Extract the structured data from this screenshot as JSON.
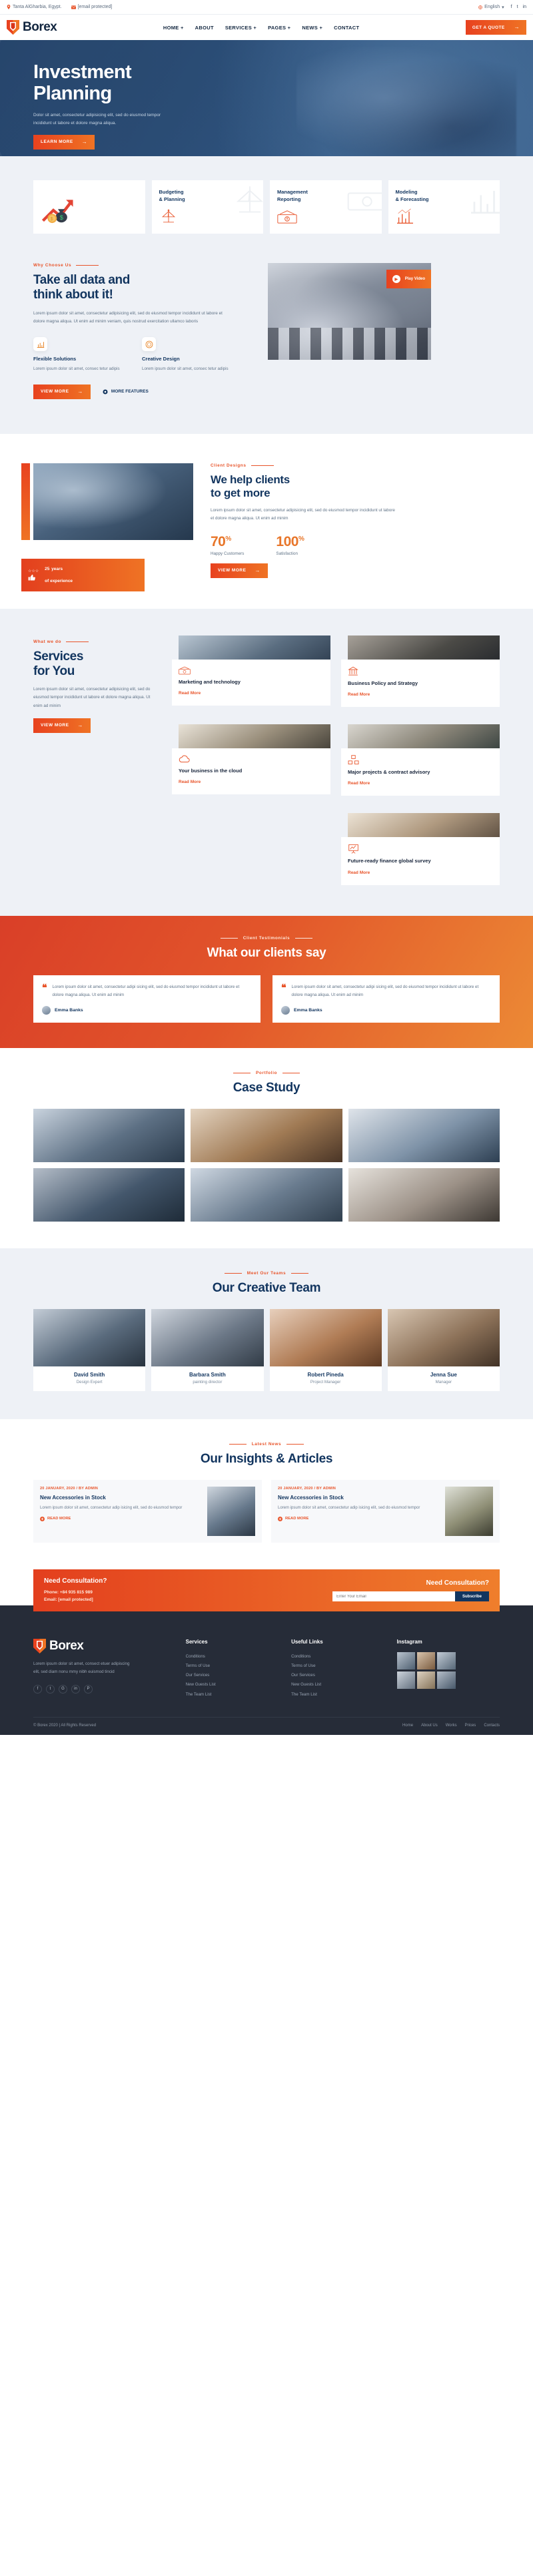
{
  "brand": {
    "name": "Borex",
    "accent": "#e8542a",
    "navy": "#12355f",
    "dark_footer": "#262c38"
  },
  "topbar": {
    "location": "Tanta AlGharbia, Egypt.",
    "email": "[email protected]",
    "language": "English",
    "location_icon": "map-pin-icon",
    "email_icon": "envelope-icon",
    "globe_icon": "globe-icon",
    "socials": [
      "f",
      "t",
      "in"
    ]
  },
  "header": {
    "nav": [
      {
        "label": "HOME +"
      },
      {
        "label": "ABOUT"
      },
      {
        "label": "SERVICES +"
      },
      {
        "label": "PAGES +"
      },
      {
        "label": "NEWS +"
      },
      {
        "label": "CONTACT"
      }
    ],
    "cta": "GET A QUOTE"
  },
  "hero": {
    "title_line1": "Investment",
    "title_line2": "Planning",
    "desc": "Dolor sit amet, consectetur adipisicing elit, sed do eiusmod tempor incididunt ut labore et dolore magna aliqua.",
    "button": "LEARN MORE"
  },
  "features": [
    {
      "title": "",
      "icon": "money-growth-icon"
    },
    {
      "title": "Budgeting\n& Planning",
      "icon": "scales-icon"
    },
    {
      "title": "Management\nReporting",
      "icon": "banknote-icon"
    },
    {
      "title": "Modeling\n& Forecasting",
      "icon": "bar-chart-icon"
    }
  ],
  "why": {
    "eyebrow": "Why Choose Us",
    "title_line1": "Take all data and",
    "title_line2": "think about it!",
    "desc": "Lorem ipsum dolor sit amet, consectetur adipisicing elit, sed do eiusmod tempor incididunt ut labore et dolore magna aliqua. Ut enim ad minim veniam, quis nostrud exercitation ullamco laboris",
    "minis": [
      {
        "title": "Flexible Solutions",
        "desc": "Lorem ipsum dolor sit amet, consec tetur adipis",
        "icon": "chart-icon"
      },
      {
        "title": "Creative Design",
        "desc": "Lorem ipsum dolor sit amet, consec tetur adipis",
        "icon": "coin-icon"
      }
    ],
    "button": "VIEW MORE",
    "more_features": "MORE FEATURES",
    "play_label": "Play Video"
  },
  "clients": {
    "eyebrow": "Client Designs",
    "title_line1": "We help clients",
    "title_line2": "to get more",
    "desc": "Lorem ipsum dolor sit amet, consectetur adipisicing elit, sed do eiusmod tempor incididunt ut labore et dolore magna aliqua. Ut enim ad minim",
    "stats": [
      {
        "value": "70",
        "unit": "%",
        "label": "Happy Customers"
      },
      {
        "value": "100",
        "unit": "%",
        "label": "Satisfaction"
      }
    ],
    "button": "VIEW MORE",
    "badge_years": "25",
    "badge_years_suffix": "years",
    "badge_text": "of experience"
  },
  "services": {
    "eyebrow": "What we do",
    "title_line1": "Services",
    "title_line2": "for You",
    "desc": "Lorem ipsum dolor sit amet, consectetur adipisicing elit, sed do eiusmod tempor incididunt ut labore et dolore magna aliqua. Ut enim ad minim",
    "button": "VIEW MORE",
    "read_more": "Read More",
    "cards": [
      {
        "title": "Marketing and technology",
        "icon": "banknote-icon"
      },
      {
        "title": "Business Policy and Strategy",
        "icon": "bank-icon"
      },
      {
        "title": "Your business in the cloud",
        "icon": "cloud-icon"
      },
      {
        "title": "Major projects & contract advisory",
        "icon": "boxes-icon"
      },
      {
        "title": "Future-ready finance global survey",
        "icon": "presentation-icon"
      }
    ]
  },
  "testimonials": {
    "eyebrow": "Client Testimonials",
    "title": "What our clients say",
    "items": [
      {
        "quote": "Lorem ipsum dolor sit amet, consectetur adipi sicing elit, sed do eiusmod tempor incididunt ut labore et dolore magna aliqua. Ut enim ad minim",
        "author": "Emma Banks"
      },
      {
        "quote": "Lorem ipsum dolor sit amet, consectetur adipi sicing elit, sed do eiusmod tempor incididunt ut labore et dolore magna aliqua. Ut enim ad minim",
        "author": "Emma Banks"
      }
    ]
  },
  "case_study": {
    "eyebrow": "Portfolio",
    "title": "Case Study",
    "cells": 6
  },
  "team": {
    "eyebrow": "Meet Our Teams",
    "title": "Our Creative Team",
    "members": [
      {
        "name": "David Smith",
        "role": "Design Expert"
      },
      {
        "name": "Barbara Smith",
        "role": "painting director"
      },
      {
        "name": "Robert Pineda",
        "role": "Project Manager"
      },
      {
        "name": "Jenna Sue",
        "role": "Manager"
      }
    ]
  },
  "news": {
    "eyebrow": "Latest News",
    "title": "Our Insights & Articles",
    "items": [
      {
        "date": "20 JANUARY, 2020 / BY ADMIN",
        "title": "New Accessories in Stock",
        "desc": "Lorem ipsum dolor sit amet, consectetur adip isicing elit, sed do eiusmod tempor",
        "more": "READ MORE"
      },
      {
        "date": "20 JANUARY, 2020 / BY ADMIN",
        "title": "New Accessories in Stock",
        "desc": "Lorem ipsum dolor sit amet, consectetur adip isicing elit, sed do eiusmod tempor",
        "more": "READ MORE"
      }
    ]
  },
  "cta": {
    "title_left": "Need Consultation?",
    "phone": "Phone: +84 935 815 989",
    "email": "Email: [email protected]",
    "title_right": "Need Consultation?",
    "placeholder": "Enter Your Email",
    "button": "Subscribe"
  },
  "footer": {
    "about": "Lorem ipsum dolor sit amet, consect etuer adipiscing elit, sed diam nonu mmy nibh euismod tincid",
    "socials": [
      "f",
      "t",
      "G",
      "in",
      "P"
    ],
    "columns": [
      {
        "heading": "Services",
        "items": [
          "Conditions",
          "Terms of Use",
          "Our Services",
          "New Guests List",
          "The Team List"
        ]
      },
      {
        "heading": "Useful Links",
        "items": [
          "Conditions",
          "Terms of Use",
          "Our Services",
          "New Guests List",
          "The Team List"
        ]
      }
    ],
    "instagram_heading": "Instagram",
    "copyright": "© Borex 2020 | All Rights Reserved",
    "bottom_links": [
      "Home",
      "About Us",
      "Works",
      "Prices",
      "Contacts"
    ]
  }
}
